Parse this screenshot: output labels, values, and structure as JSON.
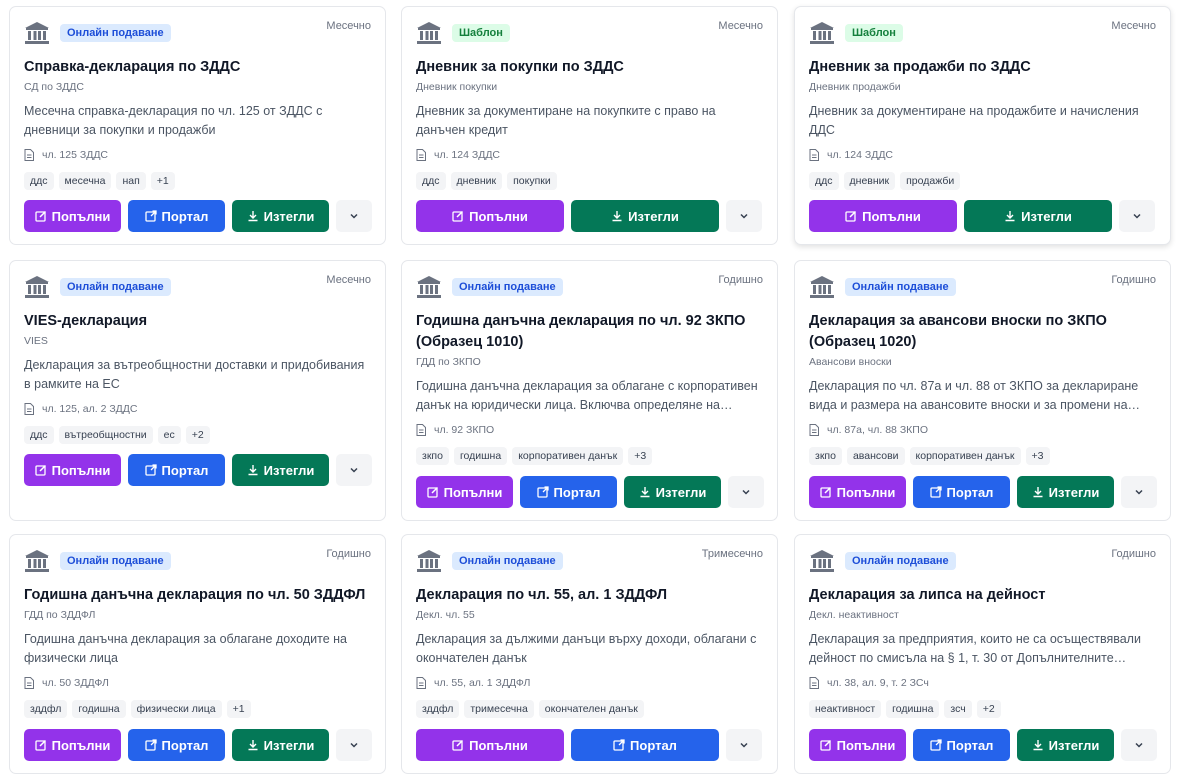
{
  "buttons": {
    "fill": "Попълни",
    "portal": "Портал",
    "download": "Изтегли"
  },
  "colors": {
    "fill": "#9333ea",
    "portal": "#2563eb",
    "download": "#047857",
    "badge_online": "#dbeafe",
    "badge_template": "#dcfce7"
  },
  "cards": [
    {
      "badge": "Онлайн подаване",
      "frequency": "Месечно",
      "title": "Справка-декларация по ЗДДС",
      "code": "СД по ЗДДС",
      "description": "Месечна справка-декларация по чл. 125 от ЗДДС с дневници за покупки и продажби",
      "reference": "чл. 125 ЗДДС",
      "tags": [
        "ддс",
        "месечна",
        "нап",
        "+1"
      ]
    },
    {
      "badge": "Шаблон",
      "frequency": "Месечно",
      "title": "Дневник за покупки по ЗДДС",
      "code": "Дневник покупки",
      "description": "Дневник за документиране на покупките с право на данъчен кредит",
      "reference": "чл. 124 ЗДДС",
      "tags": [
        "ддс",
        "дневник",
        "покупки"
      ]
    },
    {
      "badge": "Шаблон",
      "frequency": "Месечно",
      "title": "Дневник за продажби по ЗДДС",
      "code": "Дневник продажби",
      "description": "Дневник за документиране на продажбите и начисления ДДС",
      "reference": "чл. 124 ЗДДС",
      "tags": [
        "ддс",
        "дневник",
        "продажби"
      ]
    },
    {
      "badge": "Онлайн подаване",
      "frequency": "Месечно",
      "title": "VIES-декларация",
      "code": "VIES",
      "description": "Декларация за вътреобщностни доставки и придобивания в рамките на ЕС",
      "reference": "чл. 125, ал. 2 ЗДДС",
      "tags": [
        "ддс",
        "вътреобщностни",
        "ес",
        "+2"
      ]
    },
    {
      "badge": "Онлайн подаване",
      "frequency": "Годишно",
      "title": "Годишна данъчна декларация по чл. 92 ЗКПО (Образец 1010)",
      "code": "ГДД по ЗКПО",
      "description": "Годишна данъчна декларация за облагане с корпоративен данък на юридически лица. Включва определяне на…",
      "reference": "чл. 92 ЗКПО",
      "tags": [
        "зкпо",
        "годишна",
        "корпоративен данък",
        "+3"
      ]
    },
    {
      "badge": "Онлайн подаване",
      "frequency": "Годишно",
      "title": "Декларация за авансови вноски по ЗКПО (Образец 1020)",
      "code": "Авансови вноски",
      "description": "Декларация по чл. 87а и чл. 88 от ЗКПО за деклариране вида и размера на авансовите вноски и за промени на…",
      "reference": "чл. 87а, чл. 88 ЗКПО",
      "tags": [
        "зкпо",
        "авансови",
        "корпоративен данък",
        "+3"
      ]
    },
    {
      "badge": "Онлайн подаване",
      "frequency": "Годишно",
      "title": "Годишна данъчна декларация по чл. 50 ЗДДФЛ",
      "code": "ГДД по ЗДДФЛ",
      "description": "Годишна данъчна декларация за облагане доходите на физически лица",
      "reference": "чл. 50 ЗДДФЛ",
      "tags": [
        "зддфл",
        "годишна",
        "физически лица",
        "+1"
      ]
    },
    {
      "badge": "Онлайн подаване",
      "frequency": "Тримесечно",
      "title": "Декларация по чл. 55, ал. 1 ЗДДФЛ",
      "code": "Декл. чл. 55",
      "description": "Декларация за дължими данъци върху доходи, облагани с окончателен данък",
      "reference": "чл. 55, ал. 1 ЗДДФЛ",
      "tags": [
        "зддфл",
        "тримесечна",
        "окончателен данък"
      ]
    },
    {
      "badge": "Онлайн подаване",
      "frequency": "Годишно",
      "title": "Декларация за липса на дейност",
      "code": "Декл. неактивност",
      "description": "Декларация за предприятия, които не са осъществявали дейност по смисъла на § 1, т. 30 от Допълнителните…",
      "reference": "чл. 38, ал. 9, т. 2 ЗСч",
      "tags": [
        "неактивност",
        "годишна",
        "зсч",
        "+2"
      ]
    }
  ]
}
